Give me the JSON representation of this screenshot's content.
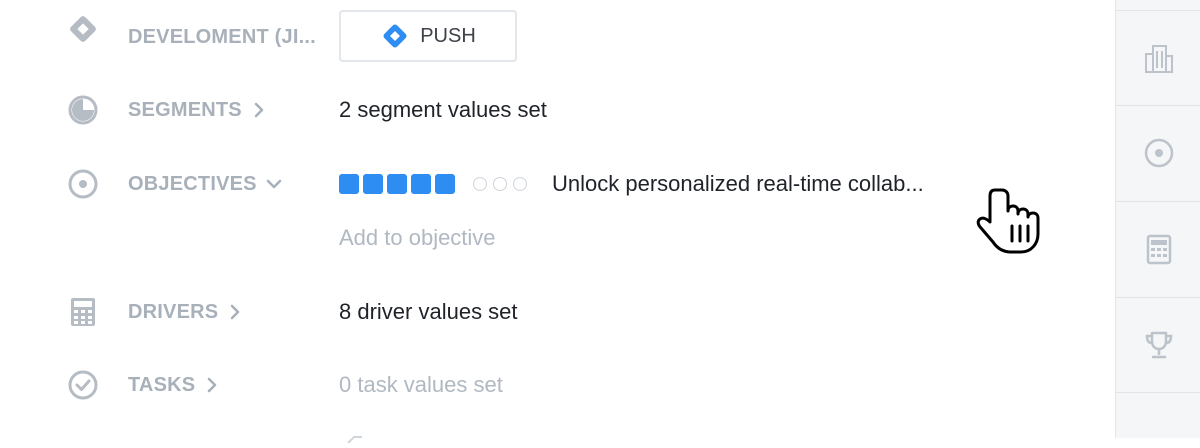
{
  "rows": {
    "development": {
      "label": "DEVELOMENT (JI...",
      "push_label": "PUSH",
      "icon": "diamond-icon"
    },
    "segments": {
      "label": "SEGMENTS",
      "value": "2 segment values set",
      "icon": "pie-chart-icon"
    },
    "objectives": {
      "label": "OBJECTIVES",
      "icon": "target-icon",
      "progress": {
        "filled": 5,
        "empty": 3
      },
      "objective_text": "Unlock personalized real-time collab...",
      "add_link": "Add to objective"
    },
    "drivers": {
      "label": "DRIVERS",
      "value": "8 driver values set",
      "icon": "calculator-icon"
    },
    "tasks": {
      "label": "TASKS",
      "value": "0 task values set",
      "icon": "check-circle-icon"
    }
  },
  "right_rail": {
    "items": [
      {
        "icon": "building-icon"
      },
      {
        "icon": "target-icon"
      },
      {
        "icon": "calculator-icon"
      },
      {
        "icon": "trophy-icon"
      }
    ]
  },
  "colors": {
    "accent": "#2d8df2",
    "label_gray": "#a8b0ba",
    "icon_gray": "#b5bcc4",
    "text": "#1f2329",
    "muted_text": "#b0b8c1",
    "rail_bg": "#f5f6f7"
  }
}
